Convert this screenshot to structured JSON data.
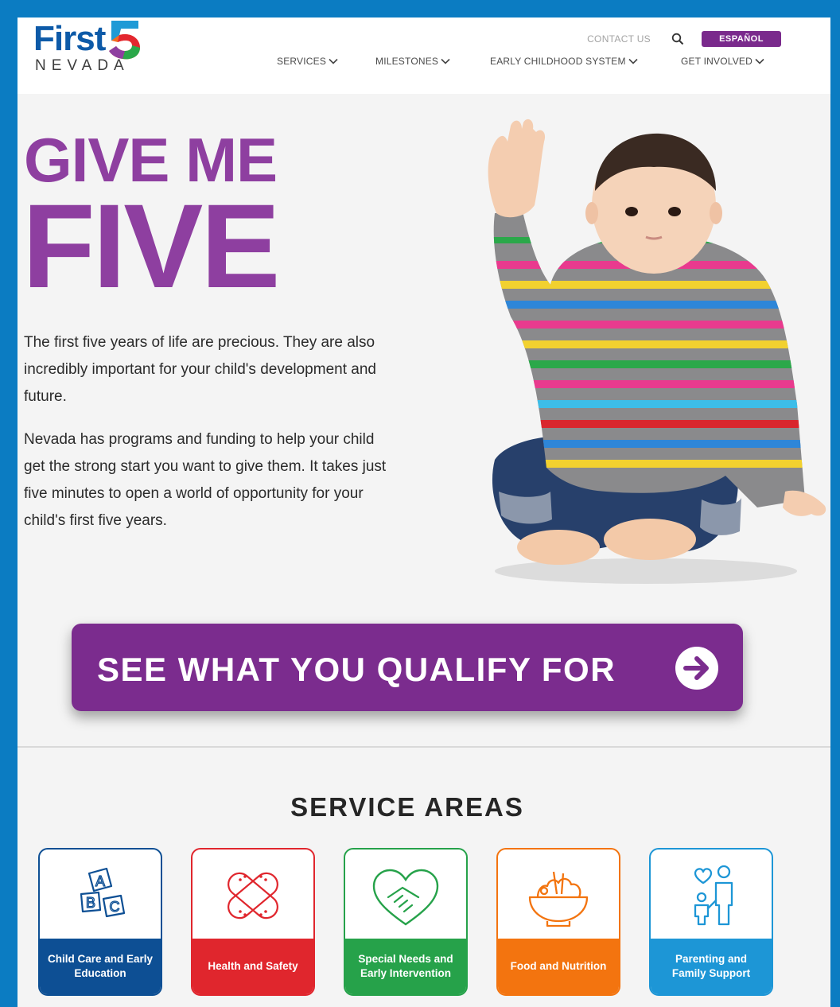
{
  "logo": {
    "first": "First",
    "nevada": "NEVADA"
  },
  "header": {
    "contact_label": "CONTACT US",
    "espanol_label": "ESPAÑOL",
    "nav": [
      {
        "label": "SERVICES"
      },
      {
        "label": "MILESTONES"
      },
      {
        "label": "EARLY CHILDHOOD SYSTEM"
      },
      {
        "label": "GET INVOLVED"
      }
    ]
  },
  "hero": {
    "headline_line1": "GIVE ME",
    "headline_line2": "FIVE",
    "paragraph1": "The first five years of life are precious. They are also incredibly important for your child's development and future.",
    "paragraph2": "Nevada has programs and funding to help your child get the strong start you want to give them. It takes just five minutes to open a world of opportunity for your child's first five years.",
    "cta_label": "SEE WHAT YOU QUALIFY FOR"
  },
  "services": {
    "title": "SERVICE AREAS",
    "cards": [
      {
        "label": "Child Care and Early Education",
        "icon": "abc-blocks-icon",
        "color": "#0d4f94"
      },
      {
        "label": "Health and Safety",
        "icon": "bandage-icon",
        "color": "#e0262d"
      },
      {
        "label": "Special Needs and Early Intervention",
        "icon": "heart-handshake-icon",
        "color": "#26a24a"
      },
      {
        "label": "Food and Nutrition",
        "icon": "food-bowl-icon",
        "color": "#f3740f"
      },
      {
        "label": "Parenting and Family Support",
        "icon": "family-icon",
        "color": "#1d96d6"
      }
    ]
  },
  "colors": {
    "brand_purple": "#8e3fa0",
    "cta_purple": "#7b2c8e",
    "frame_blue": "#0b7cc2",
    "logo_blue": "#0d5aa8"
  }
}
